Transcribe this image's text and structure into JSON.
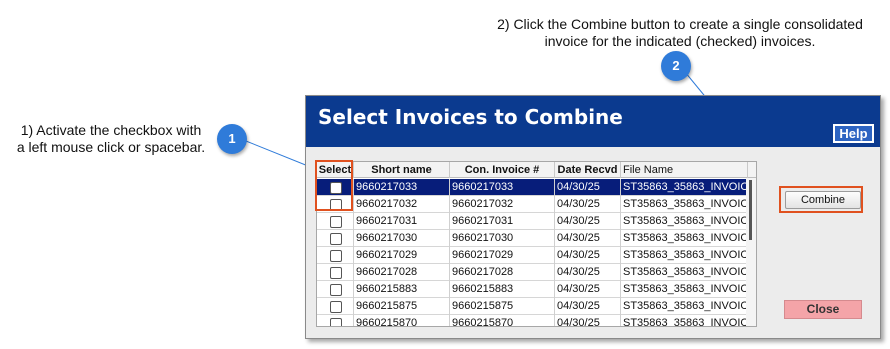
{
  "callouts": {
    "c1": {
      "badge": "1",
      "text_line1": "1) Activate the checkbox with",
      "text_line2": "a left mouse click or spacebar."
    },
    "c2": {
      "badge": "2",
      "text_line1": "2) Click the Combine button to create a single consolidated",
      "text_line2": "invoice for the indicated (checked) invoices."
    }
  },
  "dialog": {
    "title": "Select Invoices to Combine",
    "help_label": "Help",
    "combine_label": "Combine",
    "close_label": "Close"
  },
  "grid": {
    "columns": [
      "Select",
      "Short name",
      "Con. Invoice #",
      "Date Recvd",
      "File Name"
    ],
    "rows": [
      {
        "short": "9660217033",
        "invoice": "9660217033",
        "date": "04/30/25",
        "file": "ST35863_35863_INVOIC",
        "selected": true
      },
      {
        "short": "9660217032",
        "invoice": "9660217032",
        "date": "04/30/25",
        "file": "ST35863_35863_INVOIC"
      },
      {
        "short": "9660217031",
        "invoice": "9660217031",
        "date": "04/30/25",
        "file": "ST35863_35863_INVOIC"
      },
      {
        "short": "9660217030",
        "invoice": "9660217030",
        "date": "04/30/25",
        "file": "ST35863_35863_INVOIC"
      },
      {
        "short": "9660217029",
        "invoice": "9660217029",
        "date": "04/30/25",
        "file": "ST35863_35863_INVOIC"
      },
      {
        "short": "9660217028",
        "invoice": "9660217028",
        "date": "04/30/25",
        "file": "ST35863_35863_INVOIC"
      },
      {
        "short": "9660215883",
        "invoice": "9660215883",
        "date": "04/30/25",
        "file": "ST35863_35863_INVOIC"
      },
      {
        "short": "9660215875",
        "invoice": "9660215875",
        "date": "04/30/25",
        "file": "ST35863_35863_INVOIC"
      },
      {
        "short": "9660215870",
        "invoice": "9660215870",
        "date": "04/30/25",
        "file": "ST35863_35863_INVOIC"
      }
    ]
  },
  "colors": {
    "header_bg": "#0b3a8f",
    "selected_row": "#071d7a",
    "callout_badge": "#2f7bd9",
    "highlight_border": "#e0511f",
    "close_button": "#f4a4a8"
  }
}
